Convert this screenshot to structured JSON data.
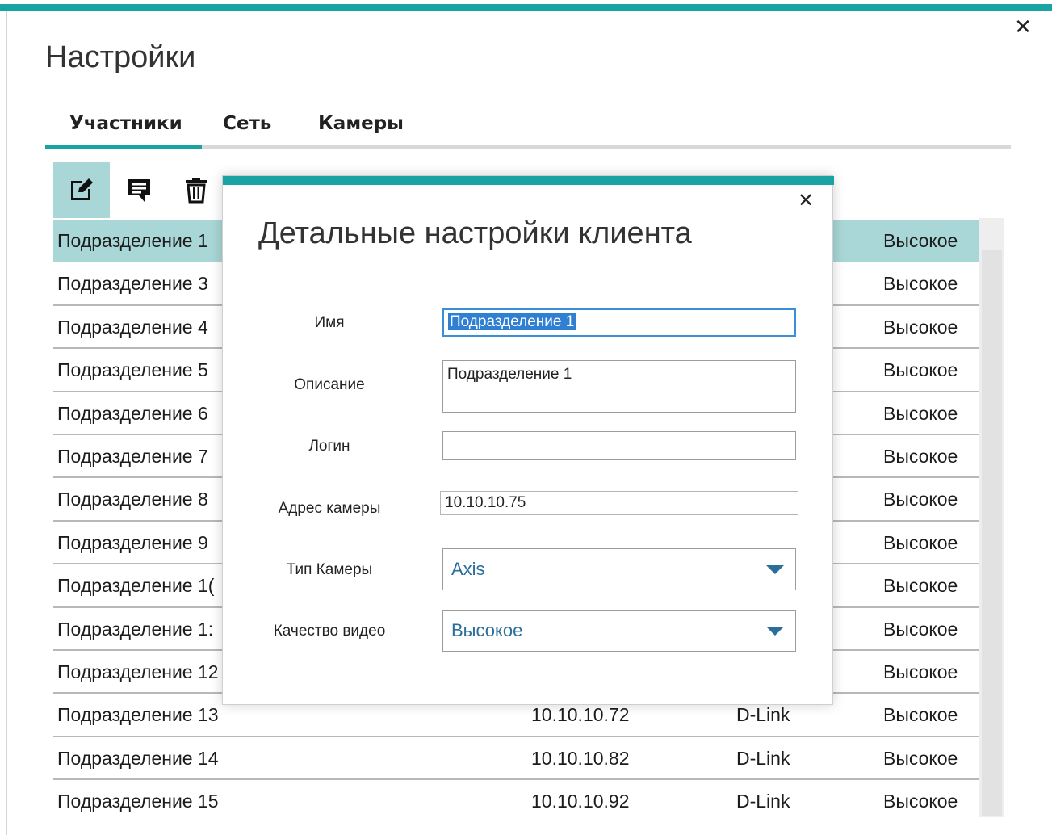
{
  "window": {
    "title": "Настройки",
    "close_glyph": "✕"
  },
  "tabs": [
    {
      "label": "Участники",
      "active": true
    },
    {
      "label": "Сеть",
      "active": false
    },
    {
      "label": "Камеры",
      "active": false
    }
  ],
  "toolbar": [
    {
      "icon": "edit-icon"
    },
    {
      "icon": "comment-icon"
    },
    {
      "icon": "trash-icon"
    }
  ],
  "rows": [
    {
      "name": "Подразделение 1",
      "ip": "",
      "type": "",
      "quality": "Высокое"
    },
    {
      "name": "Подразделение 3",
      "ip": "",
      "type": "",
      "quality": "Высокое"
    },
    {
      "name": "Подразделение 4",
      "ip": "",
      "type": "",
      "quality": "Высокое"
    },
    {
      "name": "Подразделение 5",
      "ip": "",
      "type": "",
      "quality": "Высокое"
    },
    {
      "name": "Подразделение 6",
      "ip": "",
      "type": "",
      "quality": "Высокое"
    },
    {
      "name": "Подразделение 7",
      "ip": "",
      "type": "",
      "quality": "Высокое"
    },
    {
      "name": "Подразделение 8",
      "ip": "",
      "type": "",
      "quality": "Высокое"
    },
    {
      "name": "Подразделение 9",
      "ip": "",
      "type": "",
      "quality": "Высокое"
    },
    {
      "name": "Подразделение 1(",
      "ip": "",
      "type": "",
      "quality": "Высокое"
    },
    {
      "name": "Подразделение 1:",
      "ip": "",
      "type": "",
      "quality": "Высокое"
    },
    {
      "name": "Подразделение 12",
      "ip": "",
      "type": "",
      "quality": "Высокое"
    },
    {
      "name": "Подразделение 13",
      "ip": "10.10.10.72",
      "type": "D-Link",
      "quality": "Высокое"
    },
    {
      "name": "Подразделение 14",
      "ip": "10.10.10.82",
      "type": "D-Link",
      "quality": "Высокое"
    },
    {
      "name": "Подразделение 15",
      "ip": "10.10.10.92",
      "type": "D-Link",
      "quality": "Высокое"
    }
  ],
  "dialog": {
    "title": "Детальные настройки клиента",
    "close_glyph": "✕",
    "labels": {
      "name": "Имя",
      "description": "Описание",
      "login": "Логин",
      "camera_address": "Адрес камеры",
      "camera_type": "Тип Камеры",
      "video_quality": "Качество видео"
    },
    "values": {
      "name": "Подразделение 1",
      "description": "Подразделение 1",
      "login": "",
      "camera_address": "10.10.10.75",
      "camera_type": "Axis",
      "video_quality": "Высокое"
    }
  },
  "colors": {
    "accent": "#1aa3a3",
    "selected_row": "#a9d6d6",
    "combo_text": "#2a6e9c",
    "selection": "#2f7fd2"
  }
}
